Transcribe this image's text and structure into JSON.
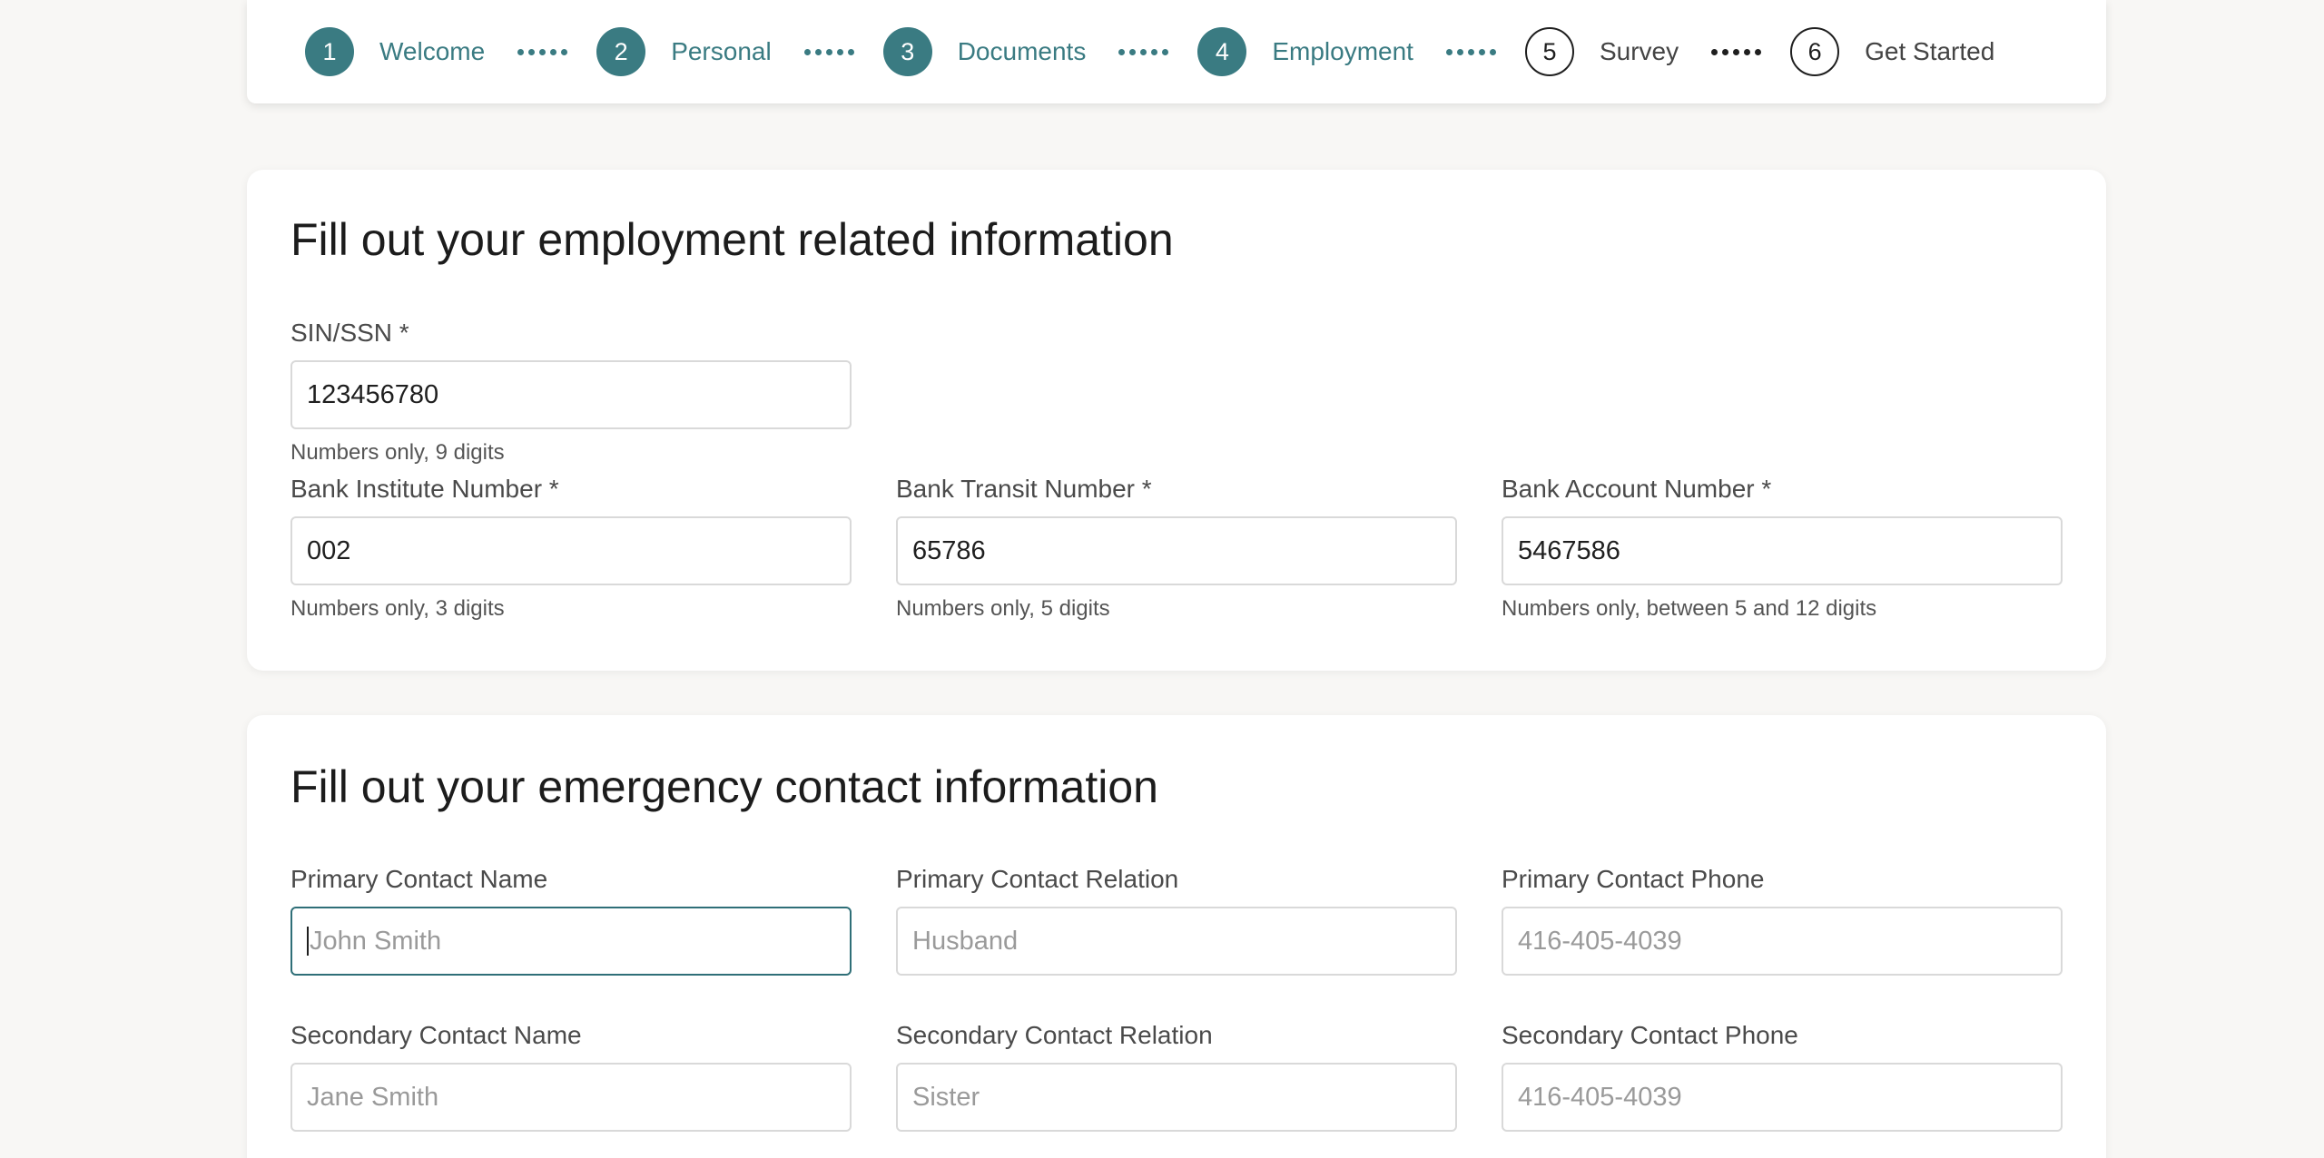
{
  "stepper": {
    "steps": [
      {
        "num": "1",
        "label": "Welcome",
        "state": "done"
      },
      {
        "num": "2",
        "label": "Personal",
        "state": "done"
      },
      {
        "num": "3",
        "label": "Documents",
        "state": "done"
      },
      {
        "num": "4",
        "label": "Employment",
        "state": "done"
      },
      {
        "num": "5",
        "label": "Survey",
        "state": "todo"
      },
      {
        "num": "6",
        "label": "Get Started",
        "state": "todo"
      }
    ]
  },
  "employment": {
    "title": "Fill out your employment related information",
    "sin": {
      "label": "SIN/SSN *",
      "value": "123456780",
      "hint": "Numbers only, 9 digits"
    },
    "institute": {
      "label": "Bank Institute Number *",
      "value": "002",
      "hint": "Numbers only, 3 digits"
    },
    "transit": {
      "label": "Bank Transit Number *",
      "value": "65786",
      "hint": "Numbers only, 5 digits"
    },
    "account": {
      "label": "Bank Account Number *",
      "value": "5467586",
      "hint": "Numbers only, between 5 and 12 digits"
    }
  },
  "emergency": {
    "title": "Fill out your emergency contact information",
    "primary_name": {
      "label": "Primary Contact Name",
      "placeholder": "John Smith"
    },
    "primary_relation": {
      "label": "Primary Contact Relation",
      "placeholder": "Husband"
    },
    "primary_phone": {
      "label": "Primary Contact Phone",
      "placeholder": "416-405-4039"
    },
    "secondary_name": {
      "label": "Secondary Contact Name",
      "placeholder": "Jane Smith"
    },
    "secondary_relation": {
      "label": "Secondary Contact Relation",
      "placeholder": "Sister"
    },
    "secondary_phone": {
      "label": "Secondary Contact Phone",
      "placeholder": "416-405-4039"
    }
  },
  "colors": {
    "accent": "#3a7b82",
    "focus_border": "#2f6f78",
    "background": "#f8f7f5"
  }
}
